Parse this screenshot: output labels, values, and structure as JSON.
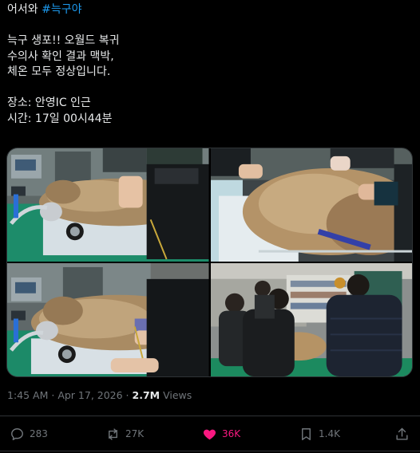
{
  "post": {
    "lines": [
      {
        "text": "어서와 ",
        "hashtag": "#늑구야"
      },
      {
        "text": ""
      },
      {
        "text": "늑구 생포!! 오월드 복귀"
      },
      {
        "text": "수의사 확인 결과 맥박,"
      },
      {
        "text": "체온 모두 정상입니다."
      },
      {
        "text": ""
      },
      {
        "text": "장소: 안영IC 인근"
      },
      {
        "text": "시간: 17일 00시44분"
      }
    ]
  },
  "meta": {
    "time": "1:45 AM",
    "separator": " · ",
    "date": "Apr 17, 2026",
    "views_count": "2.7M",
    "views_label": " Views"
  },
  "actions": {
    "replies": "283",
    "reposts": "27K",
    "likes": "36K",
    "bookmarks": "1.4K"
  },
  "colors": {
    "accent": "#1d9bf0",
    "like": "#f91880",
    "muted": "#71767b",
    "text": "#e7e9ea"
  }
}
